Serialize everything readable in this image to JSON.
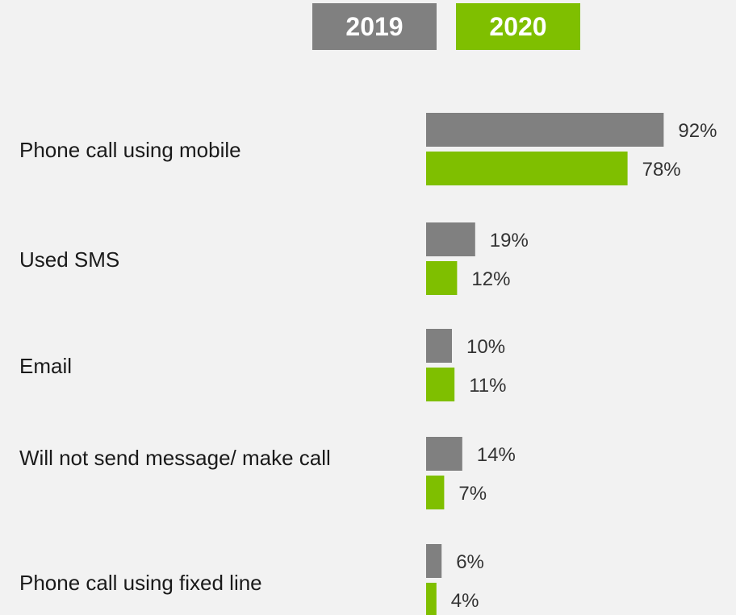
{
  "chart_data": {
    "type": "bar",
    "orientation": "horizontal",
    "categories": [
      "Phone call using mobile",
      "Used SMS",
      "Email",
      "Will not send message/ make call",
      "Phone call using fixed line"
    ],
    "series": [
      {
        "name": "2019",
        "color": "#808080",
        "values": [
          92,
          19,
          10,
          14,
          6
        ]
      },
      {
        "name": "2020",
        "color": "#7fbf00",
        "values": [
          78,
          12,
          11,
          7,
          4
        ]
      }
    ],
    "value_suffix": "%",
    "legend_position": "top",
    "grid": false,
    "xlim": [
      0,
      100
    ]
  },
  "legend": {
    "label_2019": "2019",
    "label_2020": "2020"
  }
}
